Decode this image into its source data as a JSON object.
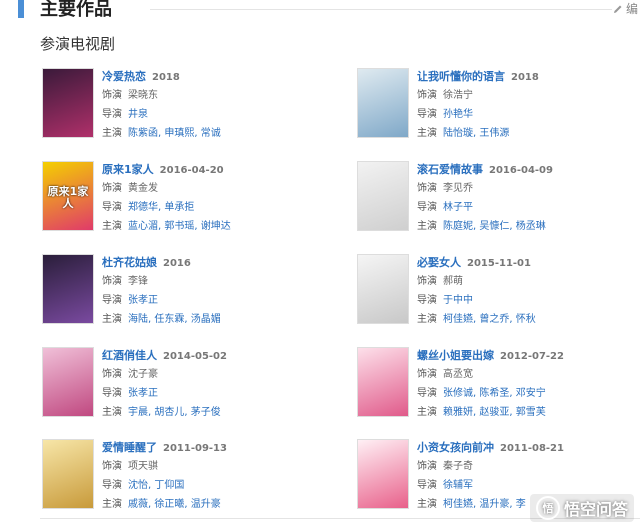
{
  "header": {
    "title": "主要作品",
    "edit_label": "编"
  },
  "sub_title": "参演电视剧",
  "labels": {
    "role": "饰演",
    "director": "导演",
    "cast": "主演"
  },
  "works": [
    {
      "name": "冷爱热恋",
      "date": "2018",
      "role": "梁晓东",
      "director": "井泉",
      "cast": "陈紫函, 申瑱熙, 常诚",
      "colors": [
        "#3a1a3a",
        "#b0306a"
      ],
      "poster_text": ""
    },
    {
      "name": "让我听懂你的语言",
      "date": "2018",
      "role": "徐浩宁",
      "director": "孙艳华",
      "cast": "陆怡璇, 王伟源",
      "colors": [
        "#dfeaf0",
        "#7fa8c8"
      ],
      "poster_text": ""
    },
    {
      "name": "原来1家人",
      "date": "2016-04-20",
      "role": "黄金发",
      "director": "郑德华, 单承拒",
      "cast": "蓝心湄, 郭书瑶, 谢坤达",
      "colors": [
        "#f4d000",
        "#e03a6a"
      ],
      "poster_text": "原来1家人"
    },
    {
      "name": "滚石爱情故事",
      "date": "2016-04-09",
      "role": "李见乔",
      "director": "林子平",
      "cast": "陈庭妮, 吴慷仁, 杨丞琳",
      "colors": [
        "#f2f2f2",
        "#cfcfcf"
      ],
      "poster_text": ""
    },
    {
      "name": "杜齐花姑娘",
      "date": "2016",
      "role": "李锋",
      "director": "张孝正",
      "cast": "海陆, 任东霖, 汤晶媚",
      "colors": [
        "#2a1e3a",
        "#7a4aa0"
      ],
      "poster_text": ""
    },
    {
      "name": "必娶女人",
      "date": "2015-11-01",
      "role": "郝萌",
      "director": "于中中",
      "cast": "柯佳嬿, 曾之乔, 怀秋",
      "colors": [
        "#f5f5f5",
        "#c8c8c8"
      ],
      "poster_text": ""
    },
    {
      "name": "红酒俏佳人",
      "date": "2014-05-02",
      "role": "沈子豪",
      "director": "张孝正",
      "cast": "宇晨, 胡杏儿, 茅子俊",
      "colors": [
        "#f0c0d8",
        "#c04880"
      ],
      "poster_text": ""
    },
    {
      "name": "螺丝小姐要出嫁",
      "date": "2012-07-22",
      "role": "高丞宽",
      "director": "张修诚, 陈希圣, 邓安宁",
      "cast": "赖雅妍, 赵骏亚, 郭雪芙",
      "colors": [
        "#fde0ea",
        "#e05a8a"
      ],
      "poster_text": ""
    },
    {
      "name": "爱情睡醒了",
      "date": "2011-09-13",
      "role": "项天骐",
      "director": "沈怡, 丁仰国",
      "cast": "戚薇, 徐正曦, 温升豪",
      "colors": [
        "#f7e6a8",
        "#c89a3a"
      ],
      "poster_text": ""
    },
    {
      "name": "小资女孩向前冲",
      "date": "2011-08-21",
      "role": "秦子奇",
      "director": "徐辅军",
      "cast": "柯佳嬿, 温升豪, 李",
      "colors": [
        "#fff0f5",
        "#e8608a"
      ],
      "poster_text": ""
    }
  ],
  "watermark": {
    "text": "悟空问答",
    "logo": "悟"
  }
}
